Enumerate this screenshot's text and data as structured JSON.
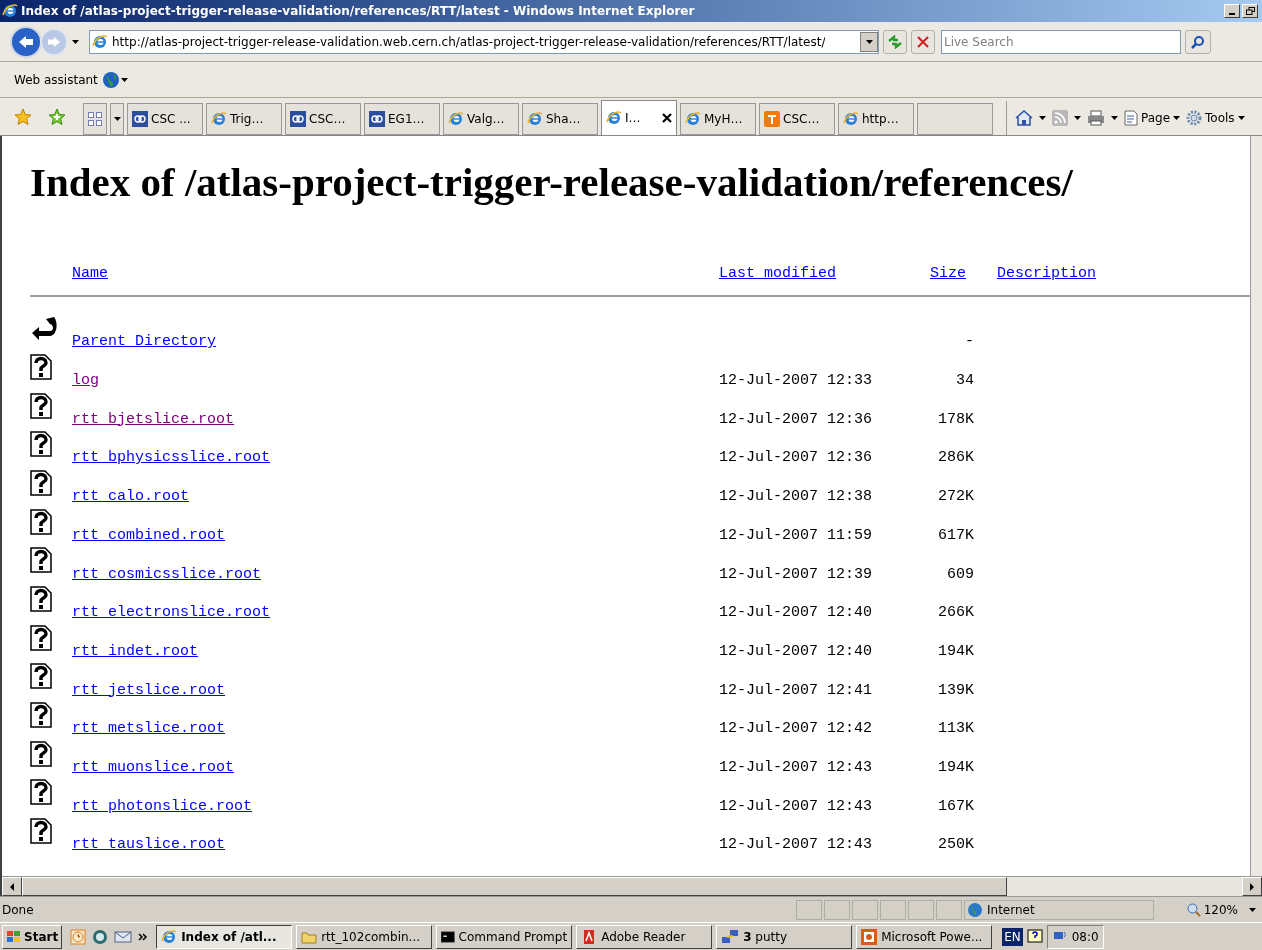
{
  "window": {
    "title": "Index of /atlas-project-trigger-release-validation/references/RTT/latest - Windows Internet Explorer"
  },
  "address_bar": {
    "value": "http://atlas-project-trigger-release-validation.web.cern.ch/atlas-project-trigger-release-validation/references/RTT/latest/"
  },
  "search": {
    "placeholder": "Live Search"
  },
  "links_bar": {
    "label": "Web assistant"
  },
  "tabs": [
    {
      "kind": "csc",
      "label": "CSC ...",
      "selected": false
    },
    {
      "kind": "ie",
      "label": "Trig…",
      "selected": false
    },
    {
      "kind": "csc",
      "label": "CSC…",
      "selected": false
    },
    {
      "kind": "csc",
      "label": "EG1…",
      "selected": false
    },
    {
      "kind": "ie",
      "label": "Valg…",
      "selected": false
    },
    {
      "kind": "ie",
      "label": "Sha…",
      "selected": false
    },
    {
      "kind": "ie",
      "label": "I…",
      "selected": true
    },
    {
      "kind": "ie",
      "label": "MyH…",
      "selected": false
    },
    {
      "kind": "t",
      "label": "CSC…",
      "selected": false
    },
    {
      "kind": "ie",
      "label": "http…",
      "selected": false
    },
    {
      "kind": "blank",
      "selected": false
    }
  ],
  "command_bar": [
    "Page",
    "Tools"
  ],
  "page": {
    "heading": "Index of /atlas-project-trigger-release-validation/references/",
    "columns": [
      "Name",
      "Last modified",
      "Size",
      "Description"
    ],
    "rows": [
      {
        "kind": "parent",
        "name": "Parent Directory",
        "visited": false,
        "size": "-"
      },
      {
        "kind": "file",
        "name": "log",
        "visited": true,
        "modified": "12-Jul-2007 12:33",
        "size": "34"
      },
      {
        "kind": "file",
        "name": "rtt_bjetslice.root",
        "visited": true,
        "modified": "12-Jul-2007 12:36",
        "size": "178K"
      },
      {
        "kind": "file",
        "name": "rtt_bphysicsslice.root",
        "visited": false,
        "modified": "12-Jul-2007 12:36",
        "size": "286K"
      },
      {
        "kind": "file",
        "name": "rtt_calo.root",
        "visited": false,
        "modified": "12-Jul-2007 12:38",
        "size": "272K"
      },
      {
        "kind": "file",
        "name": "rtt_combined.root",
        "visited": false,
        "modified": "12-Jul-2007 11:59",
        "size": "617K"
      },
      {
        "kind": "file",
        "name": "rtt_cosmicsslice.root",
        "visited": false,
        "modified": "12-Jul-2007 12:39",
        "size": "609"
      },
      {
        "kind": "file",
        "name": "rtt_electronslice.root",
        "visited": false,
        "modified": "12-Jul-2007 12:40",
        "size": "266K"
      },
      {
        "kind": "file",
        "name": "rtt_indet.root",
        "visited": false,
        "modified": "12-Jul-2007 12:40",
        "size": "194K"
      },
      {
        "kind": "file",
        "name": "rtt_jetslice.root",
        "visited": false,
        "modified": "12-Jul-2007 12:41",
        "size": "139K"
      },
      {
        "kind": "file",
        "name": "rtt_metslice.root",
        "visited": false,
        "modified": "12-Jul-2007 12:42",
        "size": "113K"
      },
      {
        "kind": "file",
        "name": "rtt_muonslice.root",
        "visited": false,
        "modified": "12-Jul-2007 12:43",
        "size": "194K"
      },
      {
        "kind": "file",
        "name": "rtt_photonslice.root",
        "visited": false,
        "modified": "12-Jul-2007 12:43",
        "size": "167K"
      },
      {
        "kind": "file",
        "name": "rtt_tauslice.root",
        "visited": false,
        "modified": "12-Jul-2007 12:43",
        "size": "250K"
      }
    ]
  },
  "status_bar": {
    "text": "Done",
    "zone": "Internet",
    "zoom": "120%"
  },
  "taskbar": {
    "start": "Start",
    "tasks": [
      {
        "kind": "ie",
        "label": "Index of /atl...",
        "selected": true
      },
      {
        "kind": "folder",
        "label": "rtt_102combin...",
        "selected": false
      },
      {
        "kind": "cmd",
        "label": "Command Prompt",
        "selected": false
      },
      {
        "kind": "pdf",
        "label": "Adobe Reader",
        "selected": false
      },
      {
        "kind": "putty",
        "label": "**3** putty",
        "selected": false
      },
      {
        "kind": "ppt",
        "label": "Microsoft Powe...",
        "selected": false
      }
    ],
    "language": "EN",
    "clock": "08:0"
  }
}
